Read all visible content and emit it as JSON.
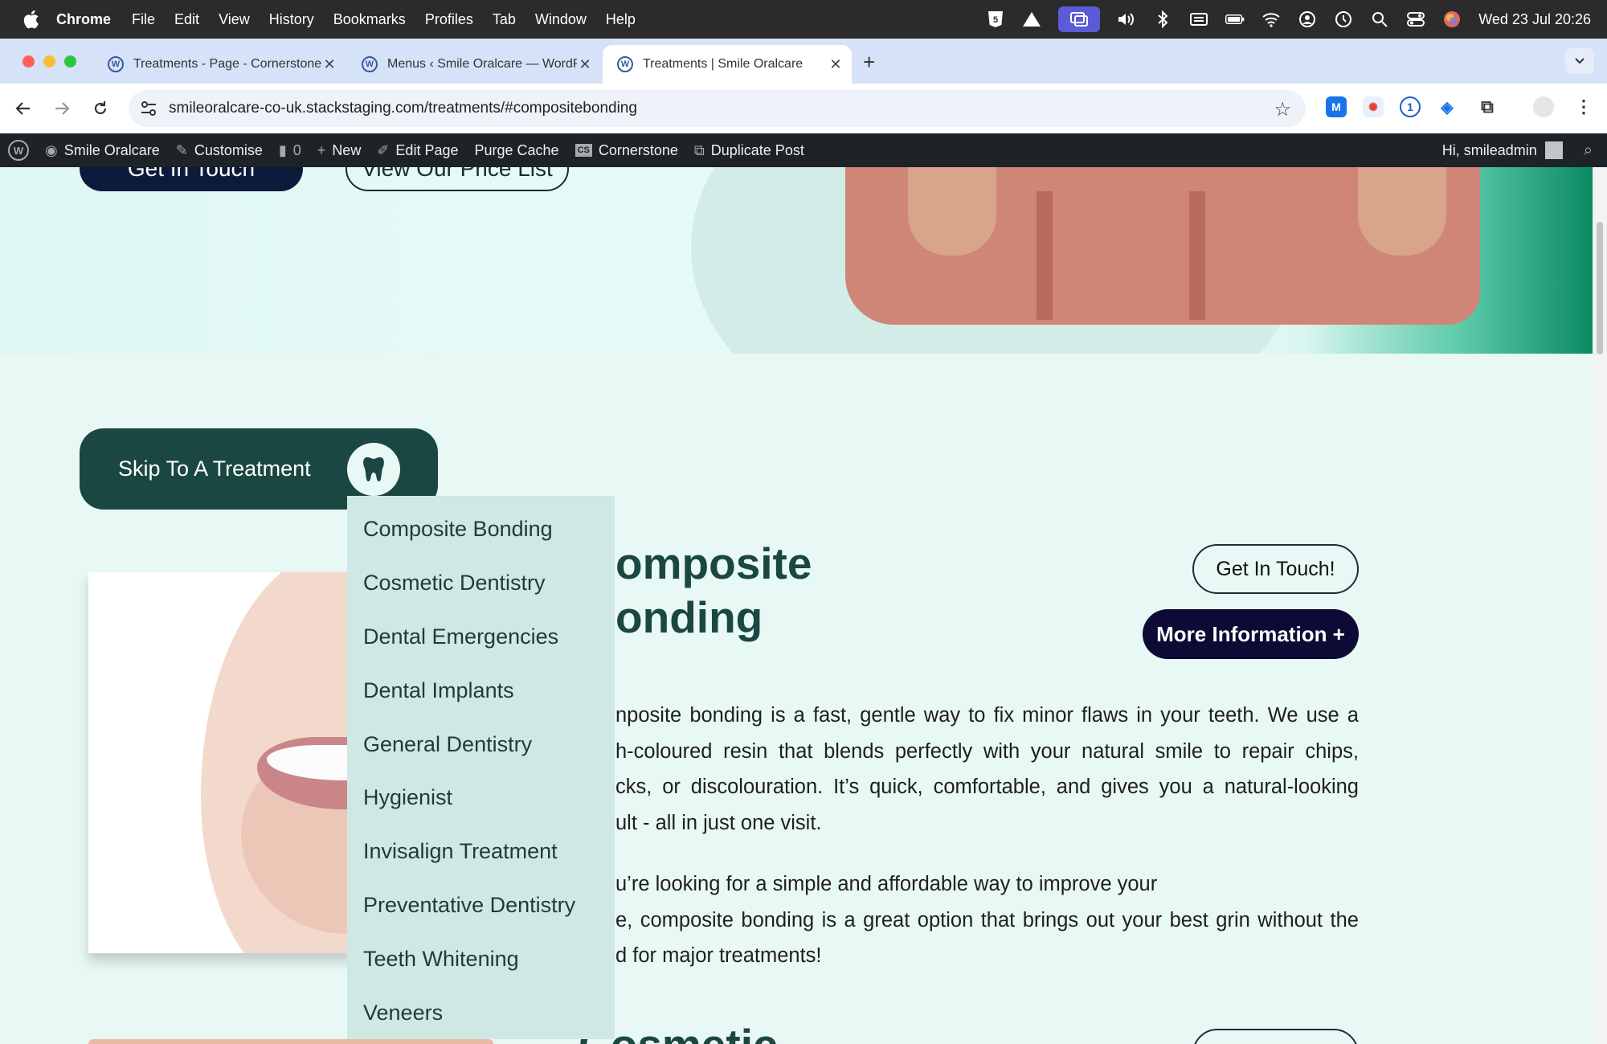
{
  "menubar": {
    "app": "Chrome",
    "items": [
      "File",
      "Edit",
      "View",
      "History",
      "Bookmarks",
      "Profiles",
      "Tab",
      "Window",
      "Help"
    ],
    "clock": "Wed 23 Jul  20:26"
  },
  "tabs": [
    {
      "label": "Treatments - Page - Cornerstone"
    },
    {
      "label": "Menus ‹ Smile Oralcare — WordPress"
    },
    {
      "label": "Treatments | Smile Oralcare"
    }
  ],
  "omnibox": {
    "url": "smileoralcare-co-uk.stackstaging.com/treatments/#compositebonding"
  },
  "wpbar": {
    "site": "Smile Oralcare",
    "customise": "Customise",
    "comments": "0",
    "new": "New",
    "edit": "Edit Page",
    "purge": "Purge Cache",
    "cornerstone_badge": "CS",
    "cornerstone": "Cornerstone",
    "duplicate": "Duplicate Post",
    "greeting": "Hi, smileadmin"
  },
  "hero": {
    "touch_btn": "Get In Touch",
    "price_btn": "View Our Price List"
  },
  "skip": {
    "label": "Skip To A Treatment"
  },
  "dropdown": {
    "items": [
      "Composite Bonding",
      "Cosmetic Dentistry",
      "Dental Emergencies",
      "Dental Implants",
      "General Dentistry",
      "Hygienist",
      "Invisalign Treatment",
      "Preventative Dentistry",
      "Teeth Whitening",
      "Veneers"
    ]
  },
  "section": {
    "heading_line1": "omposite",
    "heading_line2": "onding",
    "get_in_touch": "Get In Touch!",
    "more_info": "More Information +",
    "p1": [
      "nposite bonding is a fast, gentle way to fix minor flaws in your teeth. We use a",
      "h-coloured resin that blends perfectly with your natural smile to repair chips,",
      "cks, or discolouration. It’s quick, comfortable, and gives you a natural-looking",
      "ult - all in just one visit."
    ],
    "p2": [
      "u’re looking for a simple and affordable way to improve your",
      "e, composite bonding is a great option that brings out your best grin without the",
      "d for major treatments!"
    ],
    "next_heading": "Cosmetic"
  }
}
